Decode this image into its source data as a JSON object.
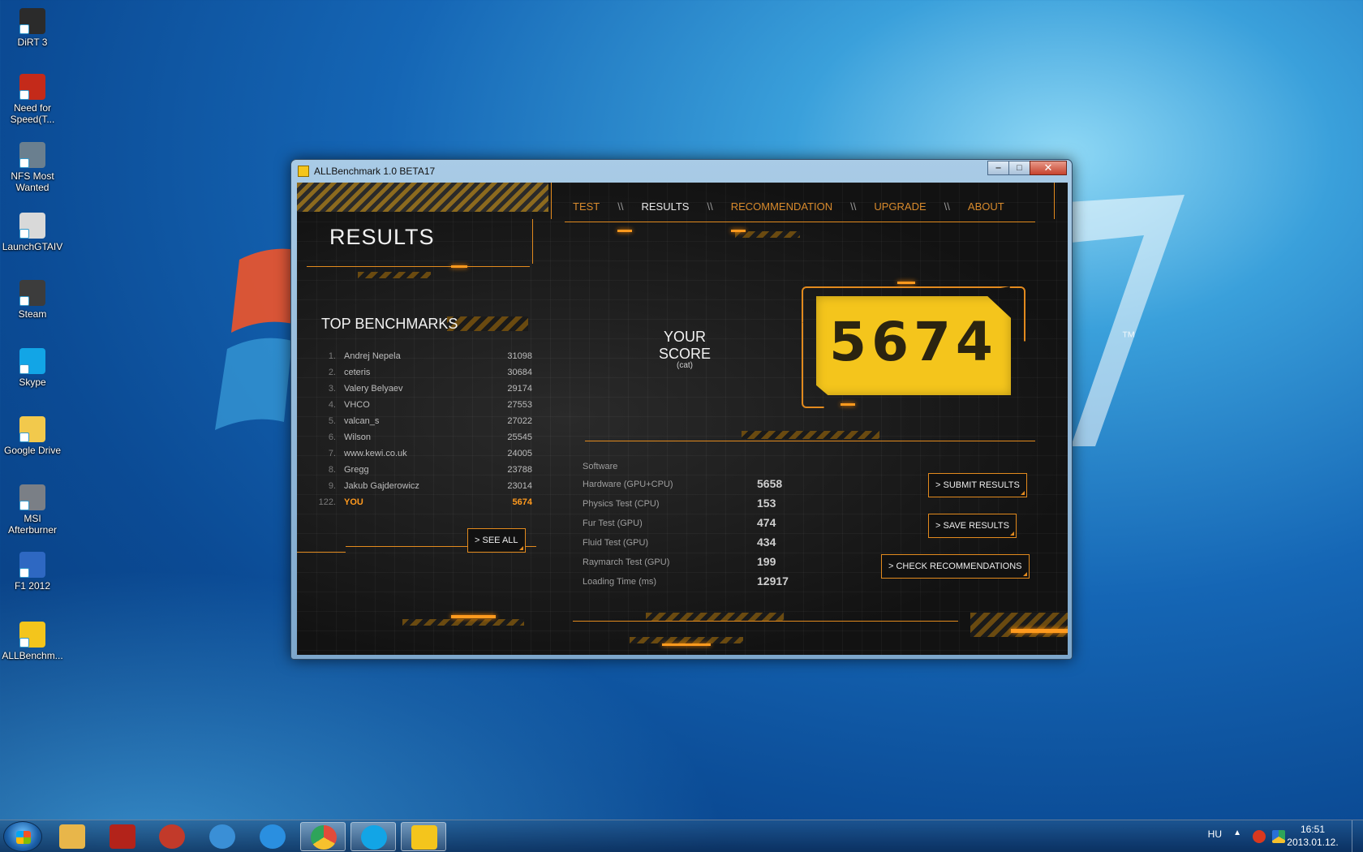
{
  "desktop": {
    "icons": [
      {
        "label": "DiRT 3",
        "icon": "dirt3-icon",
        "color": "#2b2b2b"
      },
      {
        "label": "Need for Speed(T...",
        "icon": "nfs-icon",
        "color": "#c42a1a"
      },
      {
        "label": "NFS Most Wanted",
        "icon": "nfs-most-wanted-icon",
        "color": "#6a7f8f"
      },
      {
        "label": "LaunchGTAIV",
        "icon": "gtaiv-icon",
        "color": "#d9d9d9"
      },
      {
        "label": "Steam",
        "icon": "steam-icon",
        "color": "#3c3c3c"
      },
      {
        "label": "Skype",
        "icon": "skype-icon",
        "color": "#12a5e6"
      },
      {
        "label": "Google Drive",
        "icon": "folder-icon",
        "color": "#f2c94c"
      },
      {
        "label": "MSI Afterburner",
        "icon": "msi-afterburner-icon",
        "color": "#7a7f86"
      },
      {
        "label": "F1 2012",
        "icon": "f1-2012-icon",
        "color": "#2e68c2"
      },
      {
        "label": "ALLBenchm...",
        "icon": "allbenchmark-icon",
        "color": "#f4c51c"
      }
    ]
  },
  "window": {
    "title": "ALLBenchmark 1.0 BETA17",
    "controls": {
      "minimize": "‒",
      "maximize": "□",
      "close": "✕"
    }
  },
  "nav": {
    "tabs": [
      "TEST",
      "RESULTS",
      "RECOMMENDATION",
      "UPGRADE",
      "ABOUT"
    ],
    "active": "RESULTS",
    "separator": "\\\\"
  },
  "results": {
    "title": "RESULTS",
    "top_title": "TOP BENCHMARKS",
    "leaderboard": [
      {
        "rank": "1.",
        "name": "Andrej Nepela",
        "score": "31098"
      },
      {
        "rank": "2.",
        "name": "ceteris",
        "score": "30684"
      },
      {
        "rank": "3.",
        "name": "Valery Belyaev",
        "score": "29174"
      },
      {
        "rank": "4.",
        "name": "VHCO",
        "score": "27553"
      },
      {
        "rank": "5.",
        "name": "valcan_s",
        "score": "27022"
      },
      {
        "rank": "6.",
        "name": "Wilson",
        "score": "25545"
      },
      {
        "rank": "7.",
        "name": "www.kewi.co.uk",
        "score": "24005"
      },
      {
        "rank": "8.",
        "name": "Gregg",
        "score": "23788"
      },
      {
        "rank": "9.",
        "name": "Jakub Gajderowicz",
        "score": "23014"
      }
    ],
    "you": {
      "rank": "122.",
      "name": "YOU",
      "score": "5674"
    },
    "see_all": "> SEE ALL"
  },
  "score": {
    "label": "YOUR SCORE",
    "sub": "(cat)",
    "value": "5674"
  },
  "stats": {
    "header": "Software",
    "rows": [
      {
        "label": "Hardware (GPU+CPU)",
        "value": "5658"
      },
      {
        "label": "Physics Test (CPU)",
        "value": "153"
      },
      {
        "label": "Fur Test (GPU)",
        "value": "474"
      },
      {
        "label": "Fluid Test (GPU)",
        "value": "434"
      },
      {
        "label": "Raymarch Test (GPU)",
        "value": "199"
      },
      {
        "label": "Loading Time (ms)",
        "value": "12917"
      }
    ]
  },
  "actions": {
    "submit": "> SUBMIT RESULTS",
    "save": "> SAVE RESULTS",
    "check": "> CHECK RECOMMENDATIONS"
  },
  "taskbar": {
    "items": [
      {
        "icon": "explorer-icon",
        "color": "#e8b64a"
      },
      {
        "icon": "aida64-icon",
        "color": "#b3231a"
      },
      {
        "icon": "ccleaner-icon",
        "color": "#c23a2a"
      },
      {
        "icon": "media-center-icon",
        "color": "#3a8fd6"
      },
      {
        "icon": "internet-explorer-icon",
        "color": "#2a8fe0"
      },
      {
        "icon": "chrome-icon",
        "color": "#e24b3a"
      },
      {
        "icon": "skype-icon",
        "color": "#12a5e6"
      },
      {
        "icon": "allbenchmark-icon",
        "color": "#f4c51c"
      }
    ],
    "tray": {
      "lang": "HU",
      "time": "16:51",
      "date": "2013.01.12."
    }
  }
}
